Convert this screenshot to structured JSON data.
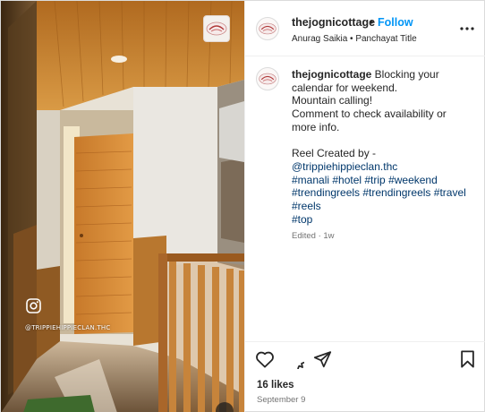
{
  "post": {
    "username": "thejognicottage",
    "follow_label": "Follow",
    "separator": "•",
    "audio_and_location": "Anurag Saikia • Panchayat Title",
    "avatar_icon": "thejognicottage-logo-icon",
    "more_icon": "more-options-icon"
  },
  "media": {
    "watermark": "@TRIPPIEHIPPIECLAN.THC",
    "instagram_glyph": "instagram-icon",
    "reel_badge_icon": "thejognicottage-logo-icon"
  },
  "caption": {
    "username": "thejognicottage",
    "text_after_username": " Blocking your",
    "line2": "calendar for weekend.",
    "line3": "Mountain calling!",
    "line4": "Comment to check availability or",
    "line5": "more info.",
    "line6": "Reel Created by -",
    "mention": "@trippiehippieclan.thc",
    "hashtags_row1": "#manali #hotel #trip #weekend",
    "hashtags_row2": "#trendingreels #trendingreels #travel",
    "hashtags_row3": "#reels",
    "hashtags_row4": "#top",
    "meta": "Edited · 1w"
  },
  "actions": {
    "like_icon": "heart-icon",
    "comment_icon": "comment-icon",
    "share_icon": "share-icon",
    "save_icon": "bookmark-icon",
    "likes": "16 likes",
    "date": "September 9"
  },
  "colors": {
    "link": "#00376b",
    "follow": "#0095f6",
    "muted": "#737373",
    "text": "#262626",
    "divider": "#efefef"
  }
}
